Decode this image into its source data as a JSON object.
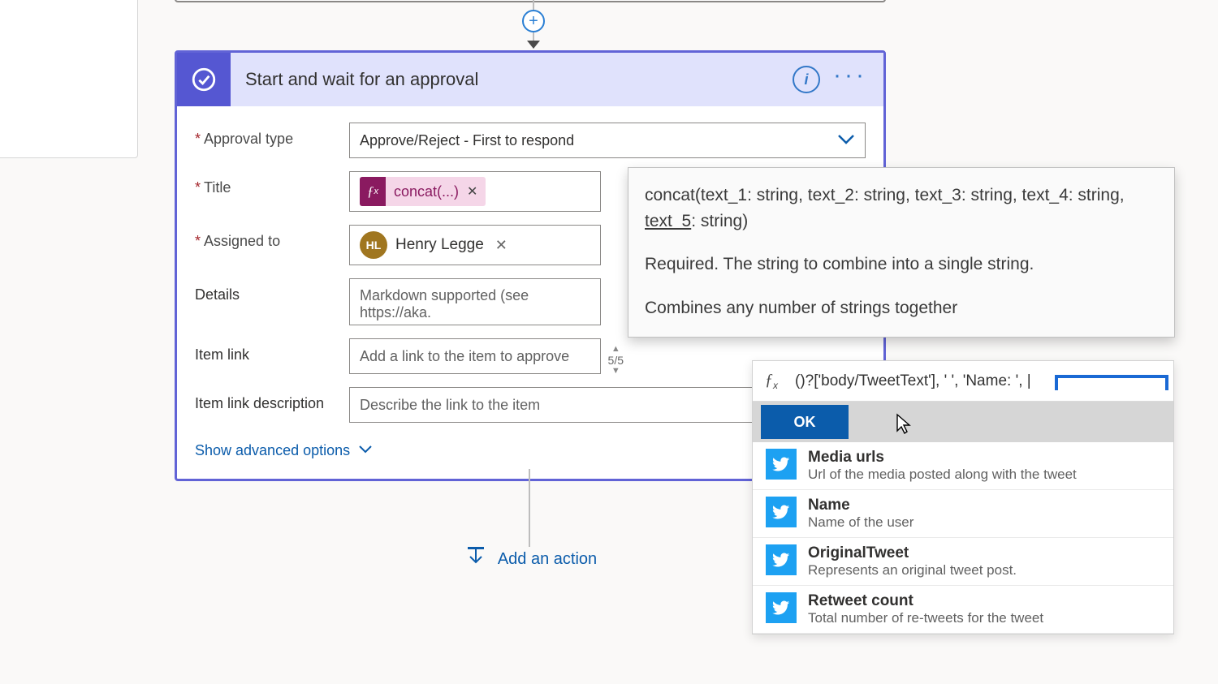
{
  "connector": {
    "plus_label": "+"
  },
  "card": {
    "title": "Start and wait for an approval",
    "info_label": "i",
    "more_label": "···"
  },
  "fields": {
    "approval_type": {
      "label": "Approval type",
      "value": "Approve/Reject - First to respond"
    },
    "title": {
      "label": "Title",
      "token": "concat(...)"
    },
    "assigned_to": {
      "label": "Assigned to",
      "person_initials": "HL",
      "person_name": "Henry Legge"
    },
    "details": {
      "label": "Details",
      "placeholder": "Markdown supported (see https://aka."
    },
    "item_link": {
      "label": "Item link",
      "placeholder": "Add a link to the item to approve",
      "counter": "5/5"
    },
    "item_link_desc": {
      "label": "Item link description",
      "placeholder": "Describe the link to the item"
    }
  },
  "advanced_link": "Show advanced options",
  "add_action": "Add an action",
  "tooltip": {
    "sig_pre": "concat(text_1: string, text_2: string, text_3: string, text_4: string, ",
    "sig_active": "text_5",
    "sig_post": ": string)",
    "desc1": "Required. The string to combine into a single string.",
    "desc2": "Combines any number of strings together"
  },
  "expression": {
    "fx_label": "fx",
    "input_value": "()?['body/TweetText'], ' ', 'Name: ', |",
    "ok_label": "OK"
  },
  "dynamic_content": [
    {
      "title": "Media urls",
      "desc": "Url of the media posted along with the tweet"
    },
    {
      "title": "Name",
      "desc": "Name of the user"
    },
    {
      "title": "OriginalTweet",
      "desc": "Represents an original tweet post."
    },
    {
      "title": "Retweet count",
      "desc": "Total number of re-tweets for the tweet"
    }
  ]
}
